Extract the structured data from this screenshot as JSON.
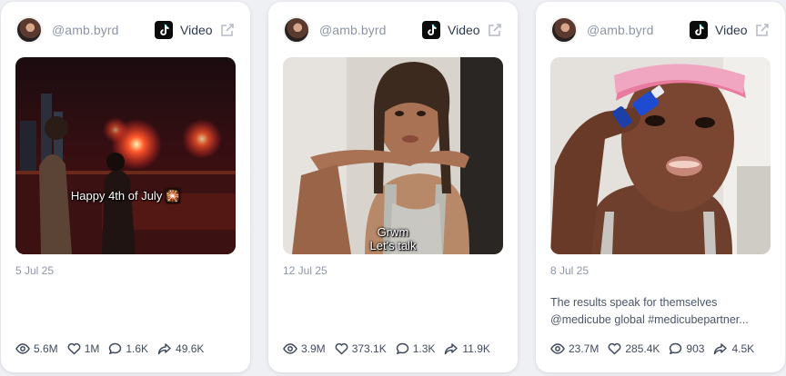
{
  "posts": [
    {
      "handle": "@amb.byrd",
      "platform": "TikTok",
      "type_label": "Video",
      "overlay_text": "Happy 4th of July 🎇",
      "date": "5 Jul 25",
      "description": "",
      "stats": {
        "views": "5.6M",
        "likes": "1M",
        "comments": "1.6K",
        "shares": "49.6K"
      }
    },
    {
      "handle": "@amb.byrd",
      "platform": "TikTok",
      "type_label": "Video",
      "overlay_text": "Grwm\nLet's talk",
      "date": "12 Jul 25",
      "description": "",
      "stats": {
        "views": "3.9M",
        "likes": "373.1K",
        "comments": "1.3K",
        "shares": "11.9K"
      }
    },
    {
      "handle": "@amb.byrd",
      "platform": "TikTok",
      "type_label": "Video",
      "overlay_text": "",
      "date": "8 Jul 25",
      "description": "The results speak for themselves @medicube global #medicubepartner...",
      "stats": {
        "views": "23.7M",
        "likes": "285.4K",
        "comments": "903",
        "shares": "4.5K"
      }
    }
  ],
  "icons": {
    "platform": "tiktok-icon",
    "open": "external-link-icon",
    "views": "eye-icon",
    "likes": "heart-icon",
    "comments": "comment-icon",
    "shares": "share-icon"
  },
  "colors": {
    "background": "#eef0f4",
    "card": "#ffffff",
    "muted_text": "#8c95a6",
    "stat_text": "#414b5e"
  }
}
